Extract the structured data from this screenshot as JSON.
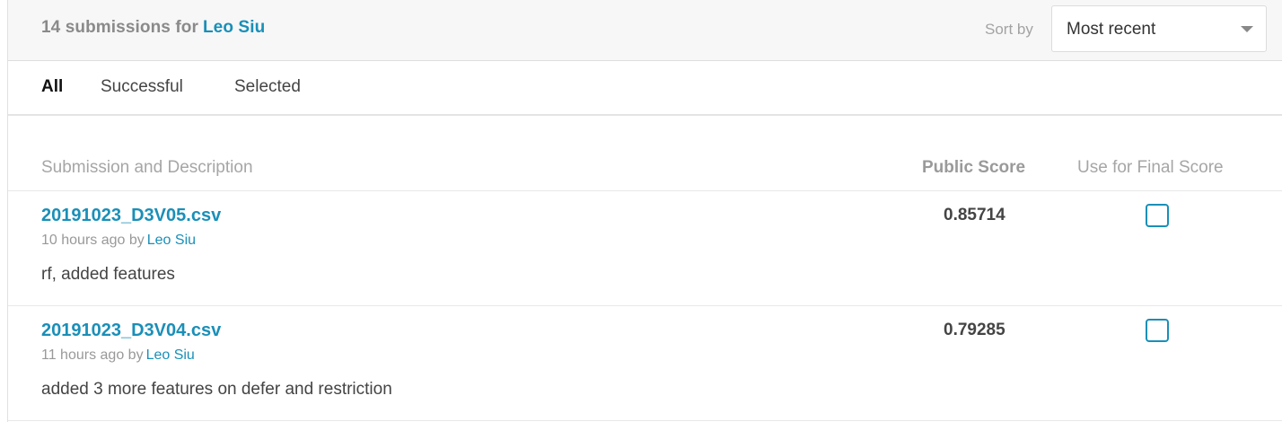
{
  "header": {
    "count_text": "14 submissions for",
    "user": "Leo Siu",
    "sort_label": "Sort by",
    "sort_value": "Most recent"
  },
  "tabs": [
    {
      "label": "All",
      "active": true
    },
    {
      "label": "Successful",
      "active": false
    },
    {
      "label": "Selected",
      "active": false
    }
  ],
  "columns": {
    "description": "Submission and Description",
    "public_score": "Public Score",
    "final": "Use for Final Score"
  },
  "submissions": [
    {
      "filename": "20191023_D3V05.csv",
      "time": "10 hours ago by",
      "user": "Leo Siu",
      "description": "rf, added features",
      "score": "0.85714",
      "selected": false
    },
    {
      "filename": "20191023_D3V04.csv",
      "time": "11 hours ago by",
      "user": "Leo Siu",
      "description": "added 3 more features on defer and restriction",
      "score": "0.79285",
      "selected": false
    }
  ],
  "colors": {
    "accent": "#1a8fb8",
    "muted": "#a6a6a6"
  }
}
